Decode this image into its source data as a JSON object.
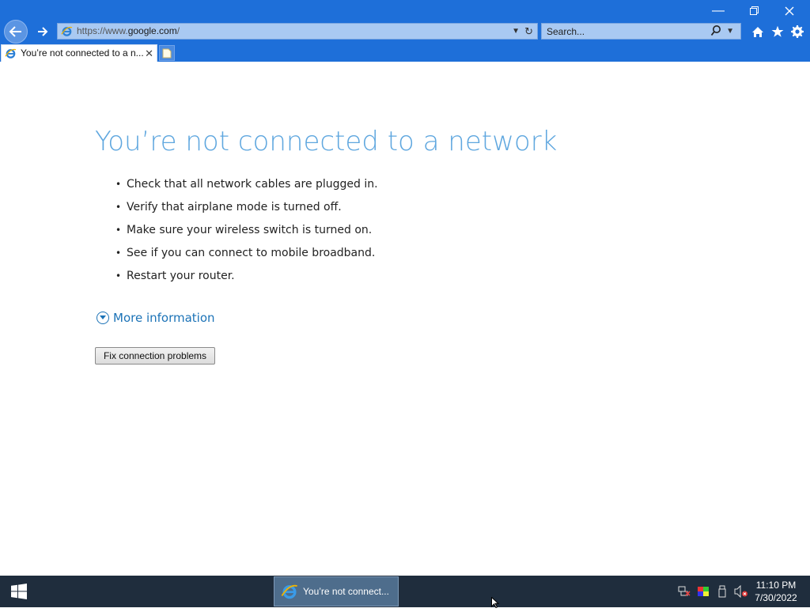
{
  "browser": {
    "address": {
      "scheme": "https://www.",
      "host": "google.com",
      "path": "/"
    },
    "search_placeholder": "Search...",
    "tab_title": "You’re not connected to a n..."
  },
  "page": {
    "heading": "You’re not connected to a network",
    "tips": [
      "Check that all network cables are plugged in.",
      "Verify that airplane mode is turned off.",
      "Make sure your wireless switch is turned on.",
      "See if you can connect to mobile broadband.",
      "Restart your router."
    ],
    "more_info": "More information",
    "fix_button": "Fix connection problems"
  },
  "taskbar": {
    "task_label": "You’re not connect...",
    "time": "11:10 PM",
    "date": "7/30/2022"
  },
  "colors": {
    "chrome": "#1e6fd9",
    "heading": "#5fa7df",
    "link": "#1c73b7",
    "taskbar": "#1f2d3d"
  }
}
